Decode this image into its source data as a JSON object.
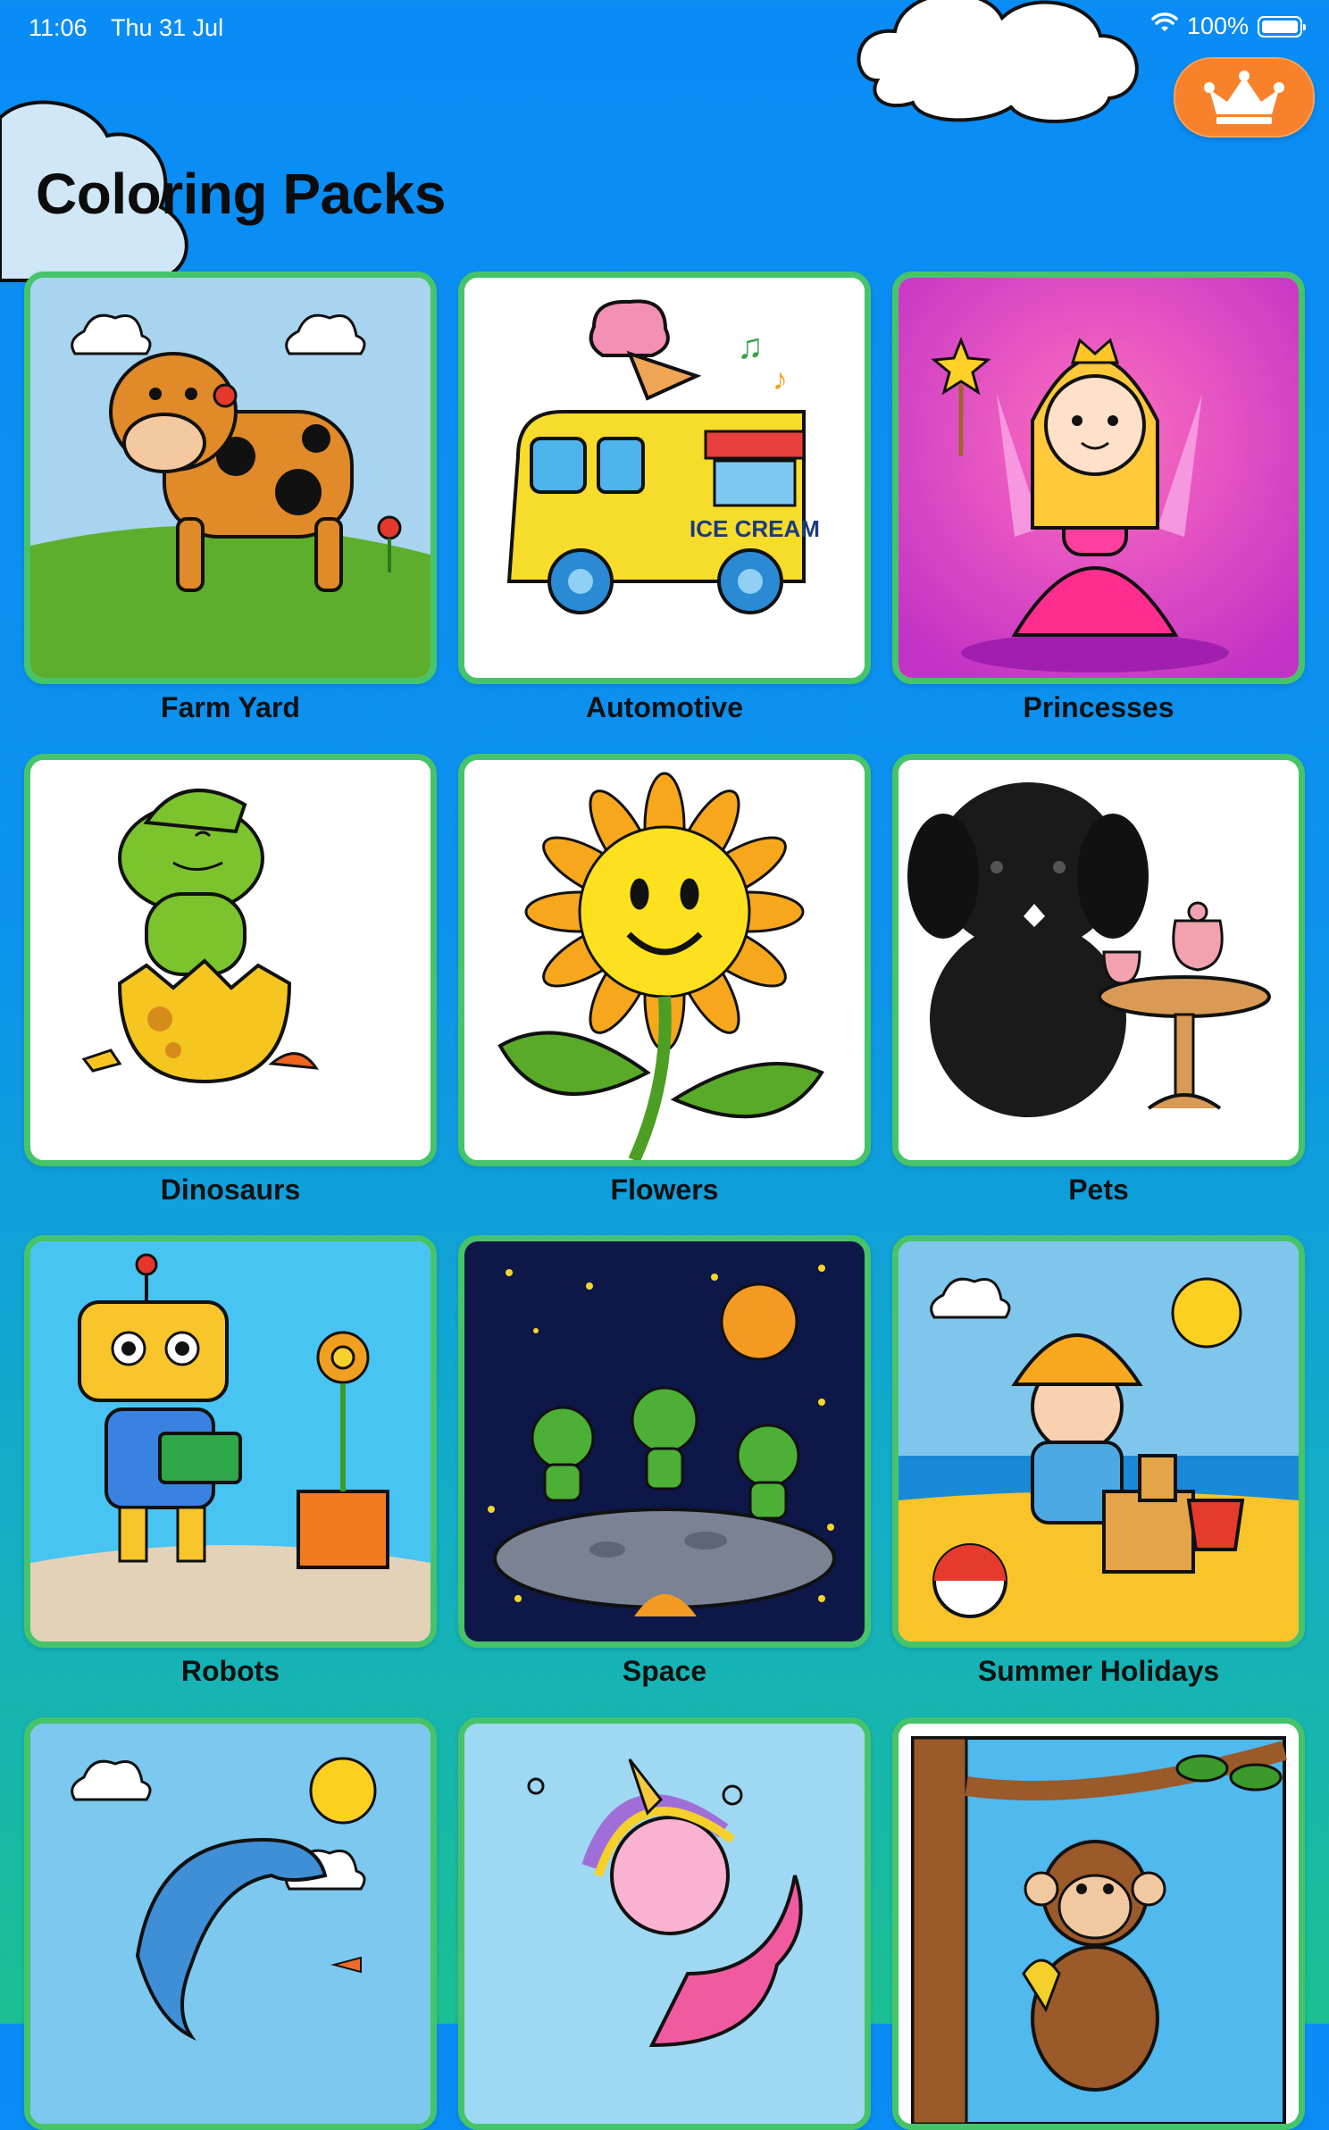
{
  "status_bar": {
    "time": "11:06",
    "date": "Thu 31 Jul",
    "battery": "100%"
  },
  "header": {
    "title": "Coloring Packs",
    "premium_icon": "crown-icon"
  },
  "colors": {
    "background_top": "#0a8cf6",
    "background_bottom": "#1cbf92",
    "card_border": "#46c46a",
    "premium_button": "#f7822b"
  },
  "packs": [
    {
      "label": "Farm Yard",
      "art": "cow-illustration"
    },
    {
      "label": "Automotive",
      "art": "ice-cream-van-illustration",
      "art_text": "ICE CREAM"
    },
    {
      "label": "Princesses",
      "art": "princess-illustration"
    },
    {
      "label": "Dinosaurs",
      "art": "baby-dinosaur-illustration"
    },
    {
      "label": "Flowers",
      "art": "sunflower-illustration"
    },
    {
      "label": "Pets",
      "art": "black-puppy-tea-party-illustration"
    },
    {
      "label": "Robots",
      "art": "robot-gardening-illustration"
    },
    {
      "label": "Space",
      "art": "aliens-on-moon-illustration"
    },
    {
      "label": "Summer Holidays",
      "art": "boy-building-sandcastle-illustration"
    },
    {
      "label": "",
      "art": "dolphin-illustration"
    },
    {
      "label": "",
      "art": "unicorn-mermaid-illustration"
    },
    {
      "label": "",
      "art": "monkey-in-tree-illustration"
    }
  ]
}
